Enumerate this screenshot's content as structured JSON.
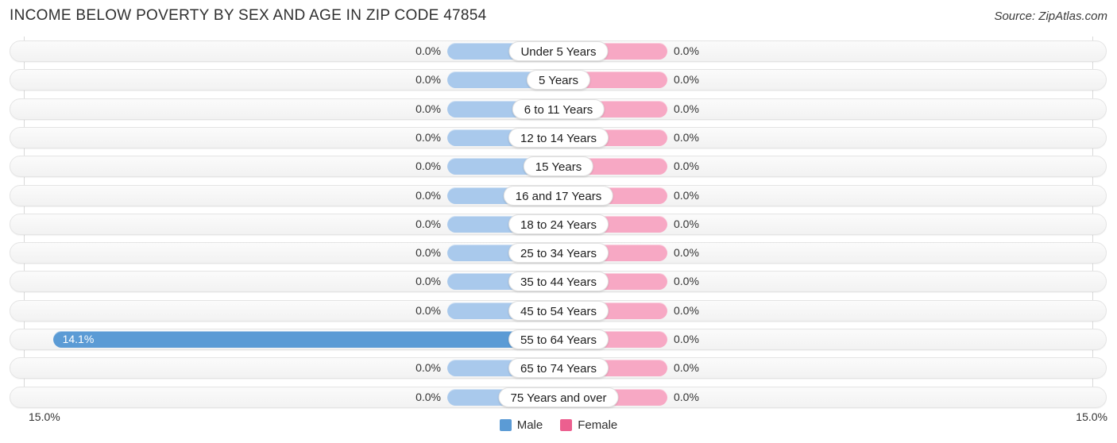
{
  "header": {
    "title": "INCOME BELOW POVERTY BY SEX AND AGE IN ZIP CODE 47854",
    "source": "Source: ZipAtlas.com"
  },
  "axis": {
    "left_label": "15.0%",
    "right_label": "15.0%"
  },
  "legend": {
    "items": [
      {
        "label": "Male",
        "color": "#5b9bd5"
      },
      {
        "label": "Female",
        "color": "#ec5f8f"
      }
    ]
  },
  "colors": {
    "male_zero": "#a9c9ec",
    "male_value": "#5b9bd5",
    "female_zero": "#f7a8c4",
    "female_value": "#ec5f8f",
    "row_track": "#f4f4f4",
    "gridline": "#d9d9d9"
  },
  "chart_data": {
    "type": "bar",
    "orientation": "horizontal",
    "layout": "diverging-bidirectional",
    "title": "INCOME BELOW POVERTY BY SEX AND AGE IN ZIP CODE 47854",
    "xlabel": "",
    "ylabel": "",
    "axis_max_percent": 15.0,
    "left_axis_label": "15.0%",
    "right_axis_label": "15.0%",
    "grid": true,
    "legend_position": "bottom-center",
    "categories": [
      "Under 5 Years",
      "5 Years",
      "6 to 11 Years",
      "12 to 14 Years",
      "15 Years",
      "16 and 17 Years",
      "18 to 24 Years",
      "25 to 34 Years",
      "35 to 44 Years",
      "45 to 54 Years",
      "55 to 64 Years",
      "65 to 74 Years",
      "75 Years and over"
    ],
    "series": [
      {
        "name": "Male",
        "side": "left",
        "color": "#5b9bd5",
        "values": [
          0.0,
          0.0,
          0.0,
          0.0,
          0.0,
          0.0,
          0.0,
          0.0,
          0.0,
          0.0,
          14.1,
          0.0,
          0.0
        ],
        "labels": [
          "0.0%",
          "0.0%",
          "0.0%",
          "0.0%",
          "0.0%",
          "0.0%",
          "0.0%",
          "0.0%",
          "0.0%",
          "0.0%",
          "14.1%",
          "0.0%",
          "0.0%"
        ]
      },
      {
        "name": "Female",
        "side": "right",
        "color": "#ec5f8f",
        "values": [
          0.0,
          0.0,
          0.0,
          0.0,
          0.0,
          0.0,
          0.0,
          0.0,
          0.0,
          0.0,
          0.0,
          0.0,
          0.0
        ],
        "labels": [
          "0.0%",
          "0.0%",
          "0.0%",
          "0.0%",
          "0.0%",
          "0.0%",
          "0.0%",
          "0.0%",
          "0.0%",
          "0.0%",
          "0.0%",
          "0.0%",
          "0.0%"
        ]
      }
    ]
  }
}
